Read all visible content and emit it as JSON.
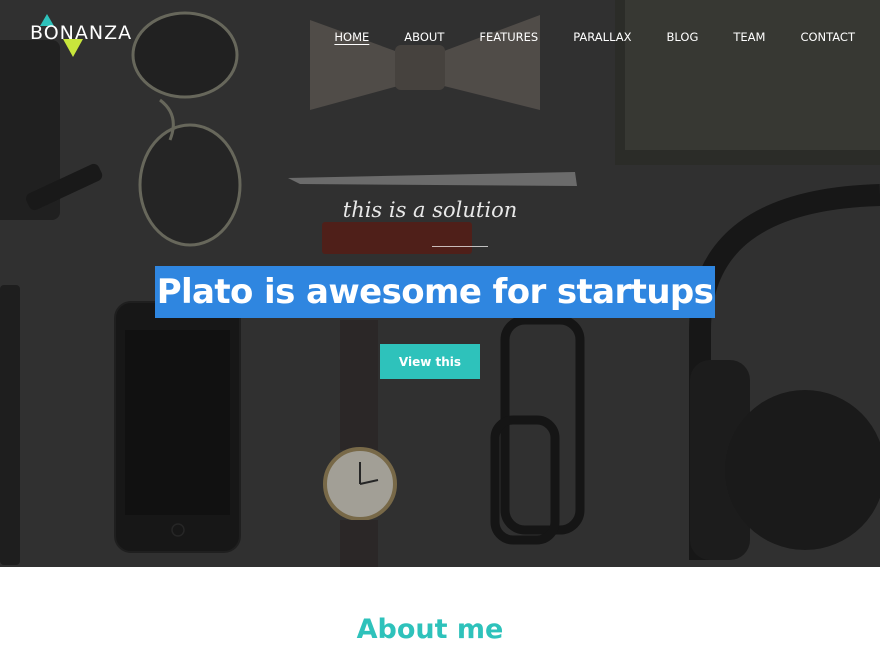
{
  "brand": {
    "name": "BONANZA",
    "colors": {
      "accent_teal": "#2ec2bb",
      "accent_lime": "#c8e63c",
      "highlight_blue": "#2f86e0"
    }
  },
  "nav": {
    "items": [
      {
        "label": "HOME",
        "active": true
      },
      {
        "label": "ABOUT"
      },
      {
        "label": "FEATURES"
      },
      {
        "label": "PARALLAX"
      },
      {
        "label": "BLOG"
      },
      {
        "label": "TEAM"
      },
      {
        "label": "CONTACT"
      }
    ]
  },
  "hero": {
    "tagline": "this is a solution",
    "headline": "Plato is awesome for startups",
    "cta_label": "View this",
    "background_description_icons": [
      "sunglasses-icon",
      "bowtie-icon",
      "pen-icon",
      "phone-icon",
      "watch-icon",
      "glasses-icon",
      "headphones-icon",
      "wallet-icon",
      "notebook-icon"
    ]
  },
  "about": {
    "title": "About me"
  }
}
